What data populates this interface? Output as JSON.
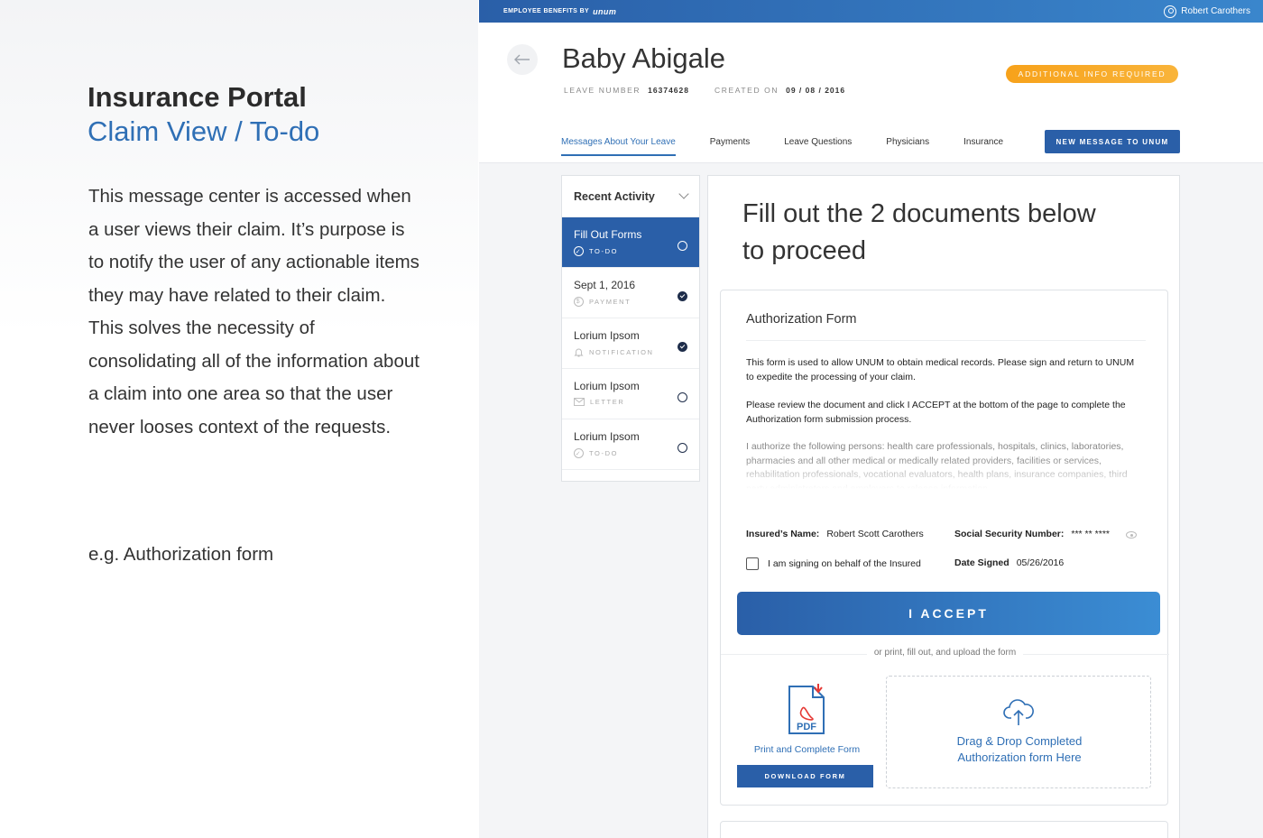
{
  "intro": {
    "title": "Insurance Portal",
    "subtitle": "Claim View / To-do",
    "body": "This message center is accessed when a user views their claim. It’s purpose is to notify the user of any actionable items they may have related to their claim. This solves the necessity of consolidating all of the information about a claim into one area so that the user never looses context of the requests.",
    "example": "e.g. Authorization form"
  },
  "topbar": {
    "brand_prefix": "EMPLOYEE BENEFITS BY",
    "brand_logo": "unum",
    "user_name": "Robert Carothers"
  },
  "header": {
    "back_icon": "arrow-left-icon",
    "title": "Baby Abigale",
    "leave_label": "LEAVE NUMBER",
    "leave_value": "16374628",
    "created_label": "CREATED ON",
    "created_value": "09 / 08 / 2016",
    "status": "ADDITIONAL INFO REQUIRED",
    "status_color": "#f7a21b"
  },
  "tabs": [
    {
      "label": "Messages About Your Leave",
      "active": true
    },
    {
      "label": "Payments"
    },
    {
      "label": "Leave Questions"
    },
    {
      "label": "Physicians"
    },
    {
      "label": "Insurance"
    }
  ],
  "new_message_label": "NEW MESSAGE TO UNUM",
  "activity": {
    "header": "Recent Activity",
    "items": [
      {
        "title": "Fill Out Forms",
        "type": "TO-DO",
        "icon": "check-circle-icon",
        "status": "open",
        "active": true
      },
      {
        "title": "Sept 1, 2016",
        "type": "PAYMENT",
        "icon": "dollar-icon",
        "status": "done"
      },
      {
        "title": "Lorium Ipsom",
        "type": "NOTIFICATION",
        "icon": "bell-icon",
        "status": "done"
      },
      {
        "title": "Lorium Ipsom",
        "type": "LETTER",
        "icon": "envelope-icon",
        "status": "open"
      },
      {
        "title": "Lorium Ipsom",
        "type": "TO-DO",
        "icon": "check-circle-icon",
        "status": "open"
      }
    ]
  },
  "main": {
    "heading": "Fill out the 2 documents below to proceed",
    "form": {
      "title": "Authorization Form",
      "p1": "This form is used to allow UNUM to obtain medical records. Please sign and return to UNUM to expedite the processing of your claim.",
      "p2": "Please review the document and click I ACCEPT at the bottom of the page to complete the Authorization form submission process.",
      "p3": "I authorize the following persons: health care professionals, hospitals, clinics, laboratories, pharmacies and all other medical or medically related providers, facilities or services, rehabilitation professionals, vocational evaluators, health plans, insurance companies, third party administrators and employers to release information",
      "insured_label": "Insured’s Name:",
      "insured_value": "Robert Scott Carothers",
      "ssn_label": "Social Security Number:",
      "ssn_value": "*** ** ****",
      "behalf_label": "I am signing on behalf of the Insured",
      "date_label": "Date Signed",
      "date_value": "05/26/2016",
      "accept_label": "I ACCEPT",
      "or_text": "or print, fill out, and upload the form",
      "pdf_label": "PDF",
      "print_label": "Print and Complete Form",
      "download_label": "DOWNLOAD FORM",
      "drop_line1": "Drag & Drop Completed",
      "drop_line2": "Authorization form Here"
    }
  },
  "colors": {
    "primary": "#2a5fa8",
    "link": "#2f6fb5",
    "warning": "#f7a21b",
    "pdf_red": "#e53935"
  }
}
